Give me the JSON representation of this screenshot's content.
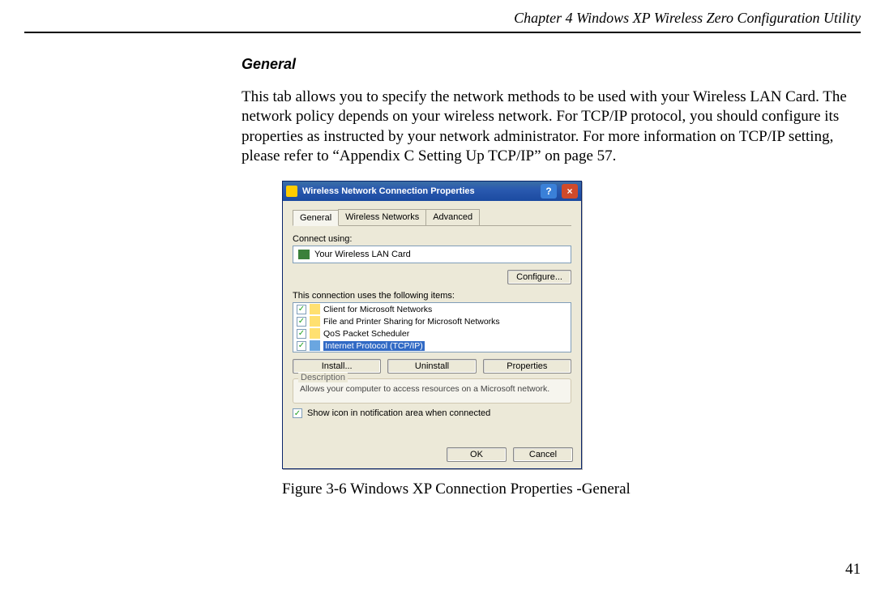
{
  "chapter_header": "Chapter 4   Windows XP Wireless Zero Configuration Utility",
  "section_title": "General",
  "body_paragraph": "This tab allows you to specify the network methods to be used with your Wireless LAN Card. The network policy depends on your wireless network. For TCP/IP protocol, you should configure its properties as instructed by your network administrator. For more information on TCP/IP setting, please refer to “Appendix C   Setting Up TCP/IP” on page 57.",
  "figure_caption": "Figure 3-6  Windows XP Connection Properties -General",
  "page_number": "41",
  "dialog": {
    "title": "Wireless Network Connection Properties",
    "tabs": {
      "general": "General",
      "wireless": "Wireless Networks",
      "advanced": "Advanced"
    },
    "connect_using_label": "Connect using:",
    "adapter_name": "Your Wireless LAN Card",
    "configure_btn": "Configure...",
    "uses_items_label": "This connection uses the following items:",
    "items": [
      {
        "label": "Client for Microsoft Networks",
        "checked": "✓"
      },
      {
        "label": "File and Printer Sharing for Microsoft Networks",
        "checked": "✓"
      },
      {
        "label": "QoS Packet Scheduler",
        "checked": "✓"
      },
      {
        "label": "Internet Protocol (TCP/IP)",
        "checked": "✓"
      }
    ],
    "install_btn": "Install...",
    "uninstall_btn": "Uninstall",
    "properties_btn": "Properties",
    "description_title": "Description",
    "description_text": "Allows your computer to access resources on a Microsoft network.",
    "show_icon_label": "Show icon in notification area when connected",
    "show_icon_checked": "✓",
    "ok_btn": "OK",
    "cancel_btn": "Cancel"
  }
}
